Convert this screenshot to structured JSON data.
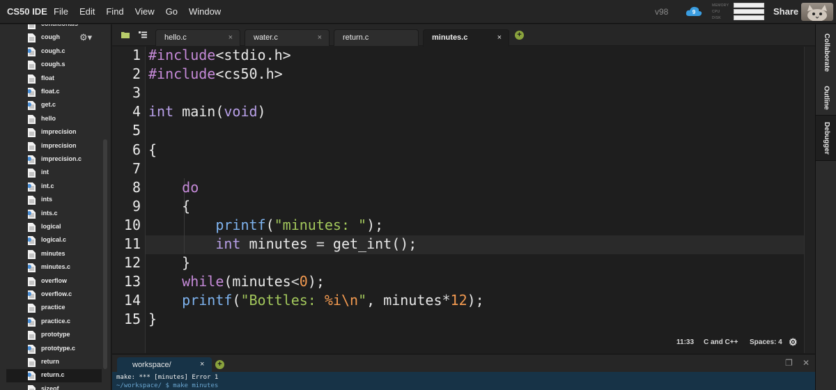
{
  "app": {
    "title": "CS50 IDE",
    "version": "v98",
    "cloud_count": "9",
    "share_label": "Share"
  },
  "menu": [
    "File",
    "Edit",
    "Find",
    "View",
    "Go",
    "Window"
  ],
  "stats": [
    "MEMORY",
    "CPU",
    "DISK"
  ],
  "file_tree": {
    "items": [
      {
        "label": "conditionals",
        "type": "doc",
        "selected": false
      },
      {
        "label": "cough",
        "type": "doc",
        "selected": false
      },
      {
        "label": "cough.c",
        "type": "c",
        "selected": false
      },
      {
        "label": "cough.s",
        "type": "doc",
        "selected": false
      },
      {
        "label": "float",
        "type": "doc",
        "selected": false
      },
      {
        "label": "float.c",
        "type": "c",
        "selected": false
      },
      {
        "label": "get.c",
        "type": "c",
        "selected": false
      },
      {
        "label": "hello",
        "type": "doc",
        "selected": false
      },
      {
        "label": "imprecision",
        "type": "doc",
        "selected": false
      },
      {
        "label": "imprecision",
        "type": "doc",
        "selected": false
      },
      {
        "label": "imprecision.c",
        "type": "c",
        "selected": false
      },
      {
        "label": "int",
        "type": "doc",
        "selected": false
      },
      {
        "label": "int.c",
        "type": "c",
        "selected": false
      },
      {
        "label": "ints",
        "type": "doc",
        "selected": false
      },
      {
        "label": "ints.c",
        "type": "c",
        "selected": false
      },
      {
        "label": "logical",
        "type": "doc",
        "selected": false
      },
      {
        "label": "logical.c",
        "type": "c",
        "selected": false
      },
      {
        "label": "minutes",
        "type": "doc",
        "selected": false
      },
      {
        "label": "minutes.c",
        "type": "c",
        "selected": false
      },
      {
        "label": "overflow",
        "type": "doc",
        "selected": false
      },
      {
        "label": "overflow.c",
        "type": "c",
        "selected": false
      },
      {
        "label": "practice",
        "type": "doc",
        "selected": false
      },
      {
        "label": "practice.c",
        "type": "c",
        "selected": false
      },
      {
        "label": "prototype",
        "type": "doc",
        "selected": false
      },
      {
        "label": "prototype.c",
        "type": "c",
        "selected": false
      },
      {
        "label": "return",
        "type": "doc",
        "selected": false
      },
      {
        "label": "return.c",
        "type": "c",
        "selected": true
      },
      {
        "label": "sizeof",
        "type": "doc",
        "selected": false
      }
    ]
  },
  "tabs": [
    {
      "label": "hello.c",
      "active": false
    },
    {
      "label": "water.c",
      "active": false
    },
    {
      "label": "return.c",
      "active": false
    },
    {
      "label": "minutes.c",
      "active": true
    }
  ],
  "tab_close": "×",
  "editor": {
    "line_numbers": [
      "1",
      "2",
      "3",
      "4",
      "5",
      "6",
      "7",
      "8",
      "9",
      "10",
      "11",
      "12",
      "13",
      "14",
      "15"
    ],
    "lines": [
      [
        {
          "t": "#include",
          "c": "kw"
        },
        {
          "t": "<stdio.h>",
          "c": ""
        }
      ],
      [
        {
          "t": "#include",
          "c": "kw"
        },
        {
          "t": "<cs50.h>",
          "c": ""
        }
      ],
      [],
      [
        {
          "t": "int",
          "c": "typ"
        },
        {
          "t": " main(",
          "c": ""
        },
        {
          "t": "void",
          "c": "typ"
        },
        {
          "t": ")",
          "c": ""
        }
      ],
      [],
      [
        {
          "t": "{",
          "c": ""
        }
      ],
      [],
      [
        {
          "t": "    ",
          "c": ""
        },
        {
          "t": "do",
          "c": "kw"
        }
      ],
      [
        {
          "t": "    {",
          "c": ""
        }
      ],
      [
        {
          "t": "        ",
          "c": ""
        },
        {
          "t": "printf",
          "c": "fn"
        },
        {
          "t": "(",
          "c": ""
        },
        {
          "t": "\"minutes: \"",
          "c": "str"
        },
        {
          "t": ");",
          "c": ""
        }
      ],
      [
        {
          "t": "        ",
          "c": ""
        },
        {
          "t": "int",
          "c": "typ"
        },
        {
          "t": " minutes ",
          "c": ""
        },
        {
          "t": "=",
          "c": "op"
        },
        {
          "t": " get_int();",
          "c": ""
        }
      ],
      [
        {
          "t": "    }",
          "c": ""
        }
      ],
      [
        {
          "t": "    ",
          "c": ""
        },
        {
          "t": "while",
          "c": "kw"
        },
        {
          "t": "(minutes",
          "c": ""
        },
        {
          "t": "<",
          "c": "op"
        },
        {
          "t": "0",
          "c": "num"
        },
        {
          "t": ");",
          "c": ""
        }
      ],
      [
        {
          "t": "    ",
          "c": ""
        },
        {
          "t": "printf",
          "c": "fn"
        },
        {
          "t": "(",
          "c": ""
        },
        {
          "t": "\"Bottles: ",
          "c": "str"
        },
        {
          "t": "%i\\n",
          "c": "num"
        },
        {
          "t": "\"",
          "c": "str"
        },
        {
          "t": ", minutes",
          "c": ""
        },
        {
          "t": "*",
          "c": "op"
        },
        {
          "t": "12",
          "c": "num"
        },
        {
          "t": ");",
          "c": ""
        }
      ],
      [
        {
          "t": "}",
          "c": ""
        }
      ]
    ]
  },
  "status_bar": {
    "position": "11:33",
    "language": "C and C++",
    "spaces": "Spaces: 4"
  },
  "right_panel": [
    "Collaborate",
    "Outline",
    "Debugger"
  ],
  "terminal": {
    "tab_label": "workspace/",
    "tab_close": "×",
    "lines": [
      "make: *** [minutes] Error 1",
      "~/workspace/ $ make minutes"
    ]
  },
  "colors": {
    "accent_green": "#8aa33d",
    "terminal_bg": "#173347",
    "keyword": "#c58ad8",
    "string": "#a3c85c",
    "number": "#f39a50"
  },
  "icons": [
    "folder-icon",
    "file-tree-icon",
    "gear-icon",
    "cloud-icon",
    "add-tab-icon",
    "maximize-icon",
    "close-icon",
    "file-c-icon",
    "file-doc-icon"
  ]
}
